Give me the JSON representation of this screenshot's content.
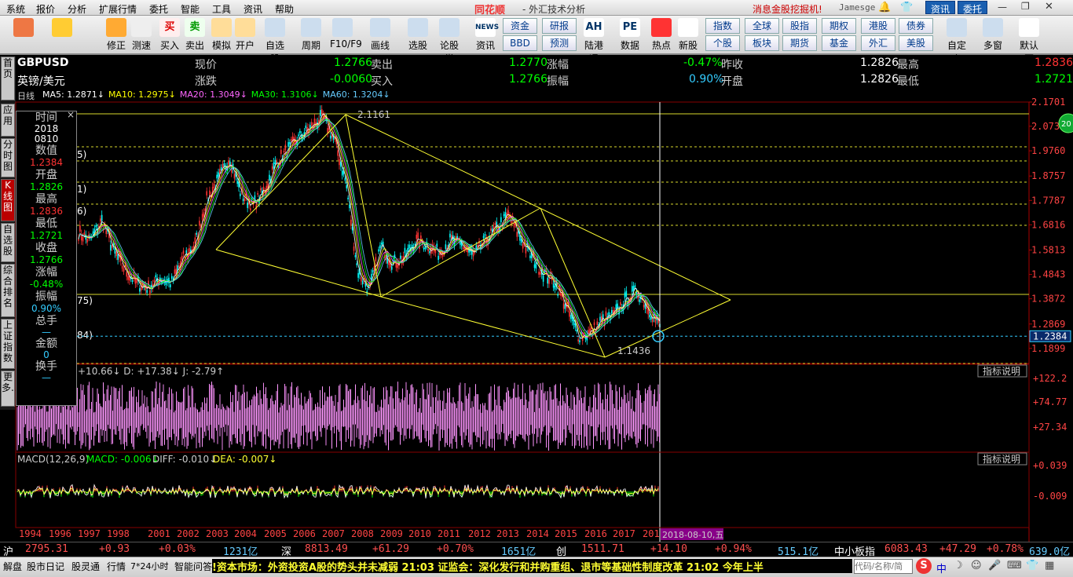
{
  "menu": [
    "系统",
    "报价",
    "分析",
    "扩展行情",
    "委托",
    "智能",
    "工具",
    "资讯",
    "帮助"
  ],
  "app_title": "同花顺",
  "subtitle": "- 外汇技术分析",
  "promo": "消息金股挖掘机!",
  "user": "Jamesge",
  "top_buttons": [
    "资讯",
    "委托"
  ],
  "toolbar": [
    {
      "label": "",
      "icon": "grid-icon"
    },
    {
      "label": "",
      "icon": "back-arrow-icon"
    },
    {
      "label": "修正",
      "icon": "refresh-icon"
    },
    {
      "label": "测速",
      "icon": "clock-icon"
    },
    {
      "label": "买入",
      "icon": "buy-icon",
      "glyph": "买"
    },
    {
      "label": "卖出",
      "icon": "sell-icon",
      "glyph": "卖"
    },
    {
      "label": "模拟",
      "icon": "hammer-icon"
    },
    {
      "label": "开户",
      "icon": "lock-icon"
    },
    {
      "label": "自选股",
      "icon": "star-icon"
    },
    {
      "label": "周期",
      "icon": "cycle-icon"
    },
    {
      "label": "F10/F9",
      "icon": "f10-icon"
    },
    {
      "label": "画线",
      "icon": "pen-icon"
    },
    {
      "label": "选股",
      "icon": "screen-icon"
    },
    {
      "label": "论股堂",
      "icon": "forum-icon"
    },
    {
      "label": "资讯",
      "icon": "news-icon",
      "glyph": "NEWS"
    },
    {
      "label": "陆港通",
      "icon": "ah-icon",
      "glyph": "AH"
    },
    {
      "label": "数据",
      "icon": "pe-icon",
      "glyph": "PE"
    },
    {
      "label": "热点",
      "icon": "hot-icon"
    },
    {
      "label": "新股",
      "icon": "newstock-icon"
    },
    {
      "label": "自定义",
      "icon": "custom-icon"
    },
    {
      "label": "多窗口",
      "icon": "windows-icon"
    },
    {
      "label": "默认页",
      "icon": "home-icon"
    }
  ],
  "toolbar_small": [
    [
      "资金",
      "BBD"
    ],
    [
      "研报",
      "预测"
    ],
    [
      "指数",
      "个股"
    ],
    [
      "全球",
      "板块"
    ],
    [
      "股指",
      "期货"
    ],
    [
      "期权",
      "基金"
    ],
    [
      "港股",
      "外汇"
    ],
    [
      "债券",
      "美股"
    ]
  ],
  "leftnav": [
    "首页",
    "应用",
    "分时图",
    "K线图",
    "自选股",
    "综合排名",
    "上证指数",
    "更多..."
  ],
  "quote": {
    "symbol": "GBPUSD",
    "name": "英镑/美元",
    "price_label": "现价",
    "price": "1.2766",
    "change_label": "涨跌",
    "change": "-0.0060",
    "sell_label": "卖出",
    "sell": "1.2770",
    "buy_label": "买入",
    "buy": "1.2766",
    "pct_label": "涨幅",
    "pct": "-0.47%",
    "amp_label": "振幅",
    "amp": "0.90%",
    "prev_label": "昨收",
    "prev": "1.2826",
    "open_label": "开盘",
    "open": "1.2826",
    "high_label": "最高",
    "high": "1.2836",
    "low_label": "最低",
    "low": "1.2721"
  },
  "ma_bar": {
    "period": "日线",
    "items": [
      {
        "label": "MA5: 1.2871↓",
        "color": "#ffffff"
      },
      {
        "label": "MA10: 1.2975↓",
        "color": "#ffff00"
      },
      {
        "label": "MA20: 1.3049↓",
        "color": "#ff66ff"
      },
      {
        "label": "MA30: 1.3106↓",
        "color": "#00ff00"
      },
      {
        "label": "MA60: 1.3204↓",
        "color": "#66ccff"
      }
    ]
  },
  "info": {
    "time_label": "时间",
    "time_y": "2018",
    "time_md": "0810",
    "value_label": "数值",
    "value": "1.2384",
    "open_label": "开盘",
    "open": "1.2826",
    "high_label": "最高",
    "high": "1.2836",
    "low_label": "最低",
    "low": "1.2721",
    "close_label": "收盘",
    "close": "1.2766",
    "pct_label": "涨幅",
    "pct": "-0.48%",
    "amp_label": "振幅",
    "amp": "0.90%",
    "vol_label": "总手",
    "vol": "—",
    "amt_label": "金额",
    "amt": "0",
    "turn_label": "换手",
    "turn": "—"
  },
  "chart_data": {
    "type": "line",
    "price_axis": [
      "2.1701",
      "2.0737",
      "1.9760",
      "1.8757",
      "1.7787",
      "1.6816",
      "1.5813",
      "1.4843",
      "1.3872",
      "1.2869",
      "1.2384",
      "1.1899"
    ],
    "current_value": "1.2384",
    "years": [
      "1994",
      "1996",
      "1997",
      "1998",
      "2001",
      "2002",
      "2003",
      "2004",
      "2005",
      "2006",
      "2007",
      "2008",
      "2009",
      "2010",
      "2011",
      "2012",
      "2013",
      "2014",
      "2015",
      "2016",
      "2017",
      "201"
    ],
    "cursor_date": "2018-08-10,五",
    "annot_high": "2.1161",
    "annot_low": "1.1436",
    "fib_labels": [
      "5)",
      "1)",
      "6)",
      "75)",
      "84)"
    ],
    "close_series": [
      1.65,
      1.62,
      1.7,
      1.58,
      1.5,
      1.45,
      1.43,
      1.47,
      1.45,
      1.55,
      1.6,
      1.78,
      1.86,
      1.95,
      1.8,
      1.76,
      1.82,
      1.93,
      1.98,
      2.03,
      2.07,
      2.11,
      2.02,
      1.85,
      1.5,
      1.42,
      1.6,
      1.53,
      1.55,
      1.62,
      1.6,
      1.57,
      1.62,
      1.6,
      1.56,
      1.62,
      1.67,
      1.72,
      1.63,
      1.55,
      1.49,
      1.45,
      1.35,
      1.24,
      1.25,
      1.3,
      1.32,
      1.38,
      1.42,
      1.35,
      1.28
    ]
  },
  "kdj": {
    "text": "+10.66↓ D: +17.38↓ J: -2.79↑",
    "axis": [
      "+122.2",
      "+74.77",
      "+27.34"
    ],
    "btn": "指标说明"
  },
  "macd": {
    "title": "MACD(12,26,9)",
    "macd": "MACD: -0.006↓",
    "diff": "DIFF: -0.010↓",
    "dea": "DEA: -0.007↓",
    "axis": [
      "+0.039",
      "-0.009"
    ],
    "btn": "指标说明"
  },
  "status": [
    {
      "t": "沪",
      "c": "#ffffff"
    },
    {
      "t": "2795.31",
      "c": "#ff5050"
    },
    {
      "t": "+0.93",
      "c": "#ff5050"
    },
    {
      "t": "+0.03%",
      "c": "#ff5050"
    },
    {
      "t": "1231亿",
      "c": "#66ccff"
    },
    {
      "t": "深",
      "c": "#ffffff"
    },
    {
      "t": "8813.49",
      "c": "#ff5050"
    },
    {
      "t": "+61.29",
      "c": "#ff5050"
    },
    {
      "t": "+0.70%",
      "c": "#ff5050"
    },
    {
      "t": "1651亿",
      "c": "#66ccff"
    },
    {
      "t": "创",
      "c": "#ffffff"
    },
    {
      "t": "1511.71",
      "c": "#ff5050"
    },
    {
      "t": "+14.10",
      "c": "#ff5050"
    },
    {
      "t": "+0.94%",
      "c": "#ff5050"
    },
    {
      "t": "515.1亿",
      "c": "#66ccff"
    },
    {
      "t": "中小板指",
      "c": "#ffffff"
    },
    {
      "t": "6083.43",
      "c": "#ff5050"
    },
    {
      "t": "+47.29",
      "c": "#ff5050"
    },
    {
      "t": "+0.78%",
      "c": "#ff5050"
    },
    {
      "t": "639.0亿",
      "c": "#66ccff"
    }
  ],
  "bottom": [
    "解盘",
    "股市日记",
    "股灵通",
    "行情",
    "7*24小时",
    "智能问答"
  ],
  "ticker": "!资本市场：外资投资A股的势头并未减弱        21:03 证监会：深化发行和并购重组、退市等基础性制度改革        21:02 今年上半",
  "search_placeholder": "代码/名称/简",
  "ime": "中"
}
